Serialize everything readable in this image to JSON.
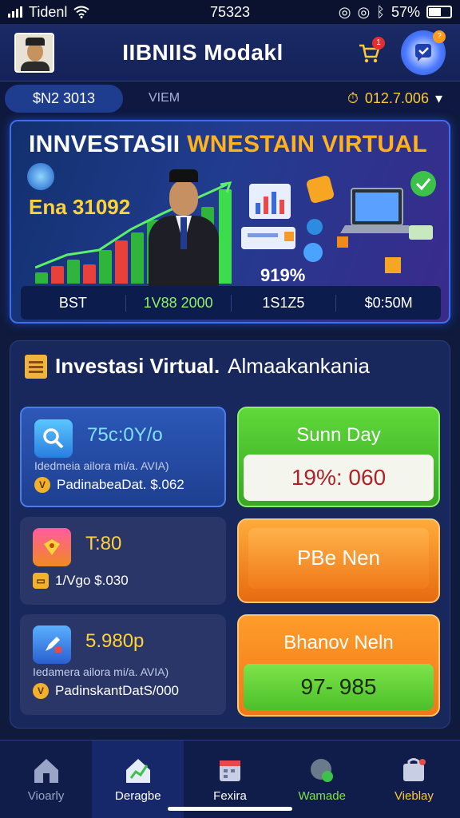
{
  "status": {
    "carrier": "Tidenl",
    "time": "75323",
    "battery": "57%",
    "battery_level": 0.57
  },
  "header": {
    "title": "IIBNIIS Modakl",
    "cart_badge": "1",
    "support_badge": "?"
  },
  "subbar": {
    "pill": "$N2 3013",
    "mid": "VIEM",
    "amount": "012.7.006"
  },
  "hero": {
    "title_white": "INNVESTASII",
    "title_yellow": "WNESTAIN VIRTUAL",
    "amount": "Ena 31092",
    "percent": "919%",
    "stats": [
      "BST",
      "1V88 2000",
      "1S1Z5",
      "$0:50M"
    ]
  },
  "panel": {
    "title": "Investasi Virtual.",
    "subtitle": "Almaakankania",
    "cards": [
      {
        "value": "75c:0Y/o",
        "desc": "Idedmeia ailora mi/a. AVIA)",
        "sub": "PadinabeaDat. $.062"
      },
      {
        "value": "T:80",
        "sub": "1/Vgo $.030"
      },
      {
        "value": "5.980p",
        "desc": "Iedamera ailora mi/a. AVIA)",
        "sub": "PadinskantDatS/000"
      }
    ],
    "actions": [
      {
        "label": "Sunn Day",
        "value": "19%: 060"
      },
      {
        "label": "PBe Nen"
      },
      {
        "label": "Bhanov Neln",
        "value": "97- 985"
      }
    ]
  },
  "nav": [
    "Vioarly",
    "Deragbe",
    "Fexira",
    "Wamade",
    "Vieblay"
  ],
  "colors": {
    "accent": "#3b6ff0",
    "green": "#5fd83a",
    "orange": "#ff8a1a",
    "gold": "#ffc83a"
  }
}
